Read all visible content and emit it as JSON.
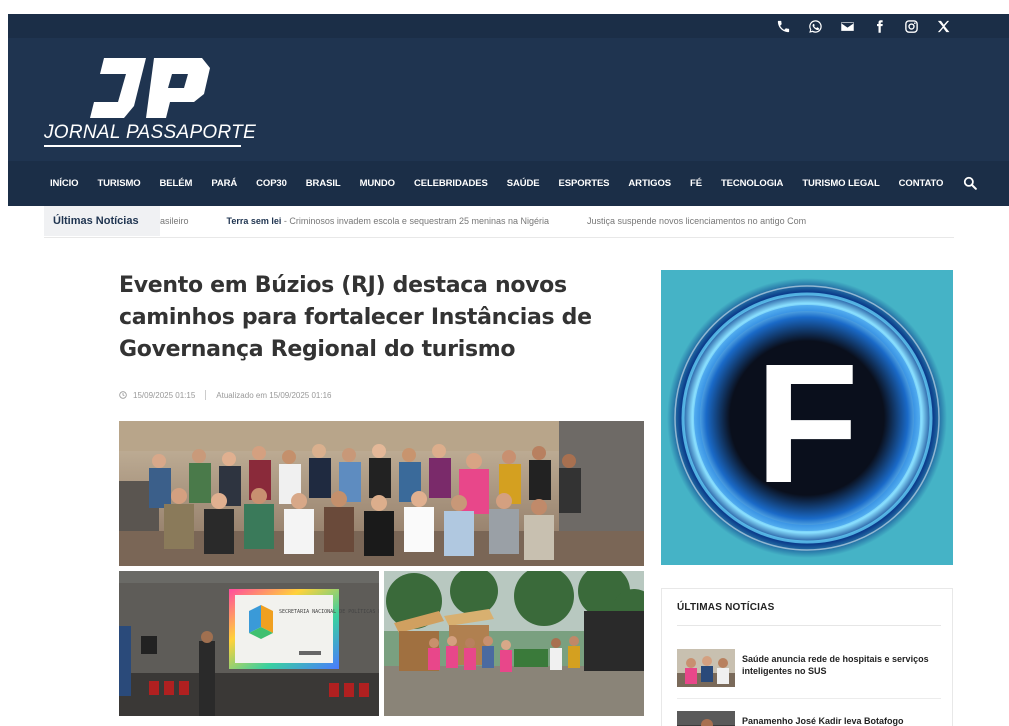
{
  "brand": {
    "logo_letters": "JP",
    "name": "JORNAL PASSAPORTE"
  },
  "social": {
    "icons": [
      "phone-icon",
      "whatsapp-icon",
      "email-icon",
      "facebook-icon",
      "instagram-icon",
      "x-icon"
    ]
  },
  "nav": {
    "items": [
      "INÍCIO",
      "TURISMO",
      "BELÉM",
      "PARÁ",
      "COP30",
      "BRASIL",
      "MUNDO",
      "CELEBRIDADES",
      "SAÚDE",
      "ESPORTES",
      "ARTIGOS",
      "FÉ",
      "TECNOLOGIA",
      "TURISMO LEGAL",
      "CONTATO"
    ]
  },
  "ticker": {
    "label": "Últimas Notícias",
    "items": [
      {
        "prefix": "",
        "text": "asileiro"
      },
      {
        "prefix": "Terra sem lei",
        "text": " - Criminosos invadem escola e sequestram 25 meninas na Nigéria"
      },
      {
        "prefix": "",
        "text": "Justiça suspende novos licenciamentos no antigo Com"
      }
    ]
  },
  "article": {
    "title": "Evento em Búzios (RJ) destaca novos caminhos para fortalecer Instâncias de Governança Regional do turismo",
    "published": "15/09/2025 01:15",
    "updated": "Atualizado em 15/09/2025 01:16",
    "slide_title": "SECRETARIA NACIONAL DE POLÍTICAS DE TURISMO"
  },
  "sidebar": {
    "ad_letter": "F",
    "latest_title": "ÚLTIMAS NOTÍCIAS",
    "news": [
      {
        "title": "Saúde anuncia rede de hospitais e serviços inteligentes no SUS"
      },
      {
        "title": "Panamenho José Kadir leva Botafogo"
      }
    ]
  },
  "colors": {
    "header_bg": "#1f3450",
    "nav_bg": "#1b2e47",
    "ad_bg": "#45b3c6",
    "ticker_label": "#1f3450"
  }
}
